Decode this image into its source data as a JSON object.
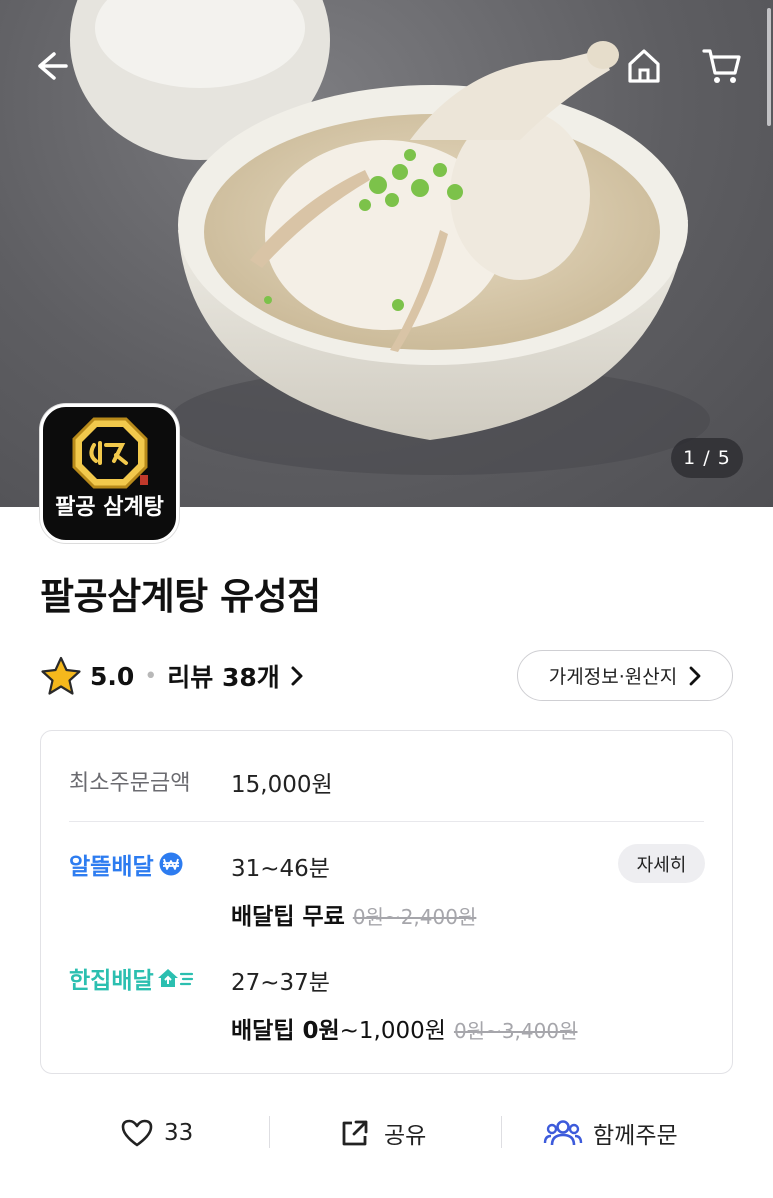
{
  "hero": {
    "image_counter": "1 / 5",
    "icons": {
      "back": "back-arrow-icon",
      "home": "home-icon",
      "cart": "cart-icon"
    }
  },
  "store": {
    "logo_text": "팔공 삼계탕",
    "name": "팔공삼계탕 유성점",
    "rating": "5.0",
    "review_label": "리뷰 38개",
    "info_button": "가게정보·원산지"
  },
  "delivery_card": {
    "min_order_label": "최소주문금액",
    "min_order_value": "15,000원",
    "options": [
      {
        "name": "알뜰배달",
        "time": "31~46분",
        "fee_bold": "배달팁 무료",
        "fee_rest": "",
        "fee_original": "0원~2,400원",
        "color": "#2d7cf0",
        "detail_button": "자세히"
      },
      {
        "name": "한집배달",
        "time": "27~37분",
        "fee_bold": "배달팁 0원",
        "fee_rest": "~1,000원",
        "fee_original": "0원~3,400원",
        "color": "#2bbfb0"
      }
    ]
  },
  "actions": {
    "like_count": "33",
    "share_label": "공유",
    "group_order_label": "함께주문"
  },
  "colors": {
    "accent_blue": "#2d7cf0",
    "accent_teal": "#2bbfb0",
    "star": "#f5b81c"
  }
}
